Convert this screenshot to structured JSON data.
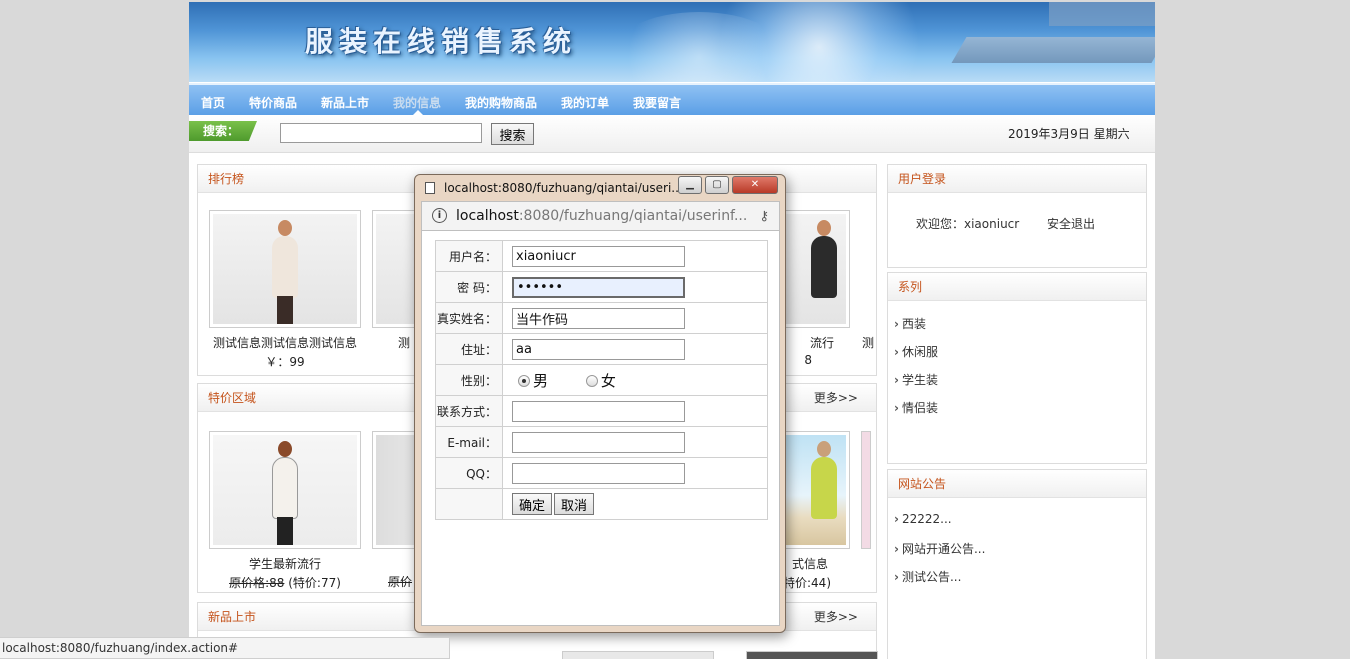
{
  "banner": {
    "title": "服装在线销售系统"
  },
  "nav": [
    {
      "label": "首页"
    },
    {
      "label": "特价商品"
    },
    {
      "label": "新品上市"
    },
    {
      "label": "我的信息"
    },
    {
      "label": "我的购物商品"
    },
    {
      "label": "我的订单"
    },
    {
      "label": "我要留言"
    }
  ],
  "search": {
    "tag": "搜索：",
    "value": "",
    "button": "搜索"
  },
  "date": "2019年3月9日 星期六",
  "ranking": {
    "title": "排行榜",
    "items": [
      {
        "name": "测试信息测试信息测试信息",
        "price": "￥：99"
      },
      {
        "name": "测"
      },
      {
        "name": "流行",
        "price": "8"
      },
      {
        "name": "测"
      }
    ]
  },
  "special": {
    "title": "特价区域",
    "more": "更多>>",
    "items": [
      {
        "name": "学生最新流行",
        "orig": "原价格:88",
        "sale": "(特价:77)"
      },
      {
        "orig": "原价"
      },
      {
        "name": "式信息",
        "sale": "特价:44)"
      }
    ]
  },
  "newarrivals": {
    "title": "新品上市",
    "more": "更多>>"
  },
  "login": {
    "title": "用户登录",
    "welcome": "欢迎您：xiaoniucr",
    "logout": "安全退出"
  },
  "series": {
    "title": "系列",
    "items": [
      "西装",
      "休闲服",
      "学生装",
      "情侣装"
    ]
  },
  "notice": {
    "title": "网站公告",
    "items": [
      "22222...",
      "网站开通公告...",
      "测试公告..."
    ]
  },
  "popup": {
    "window_title": "localhost:8080/fuzhuang/qiantai/useri...",
    "address_host": "localhost",
    "address_rest": ":8080/fuzhuang/qiantai/userinf...",
    "fields": {
      "username_label": "用户名：",
      "username": "xiaoniucr",
      "password_label": "密 码：",
      "password": "••••••",
      "realname_label": "真实姓名：",
      "realname": "当牛作码",
      "address_label": "住址：",
      "address": "aa",
      "gender_label": "性别：",
      "gender_male": "男",
      "gender_female": "女",
      "contact_label": "联系方式：",
      "contact": "",
      "email_label": "E-mail：",
      "email": "",
      "qq_label": "QQ：",
      "qq": ""
    },
    "confirm": "确定",
    "cancel": "取消"
  },
  "statusbar": "localhost:8080/fuzhuang/index.action#"
}
